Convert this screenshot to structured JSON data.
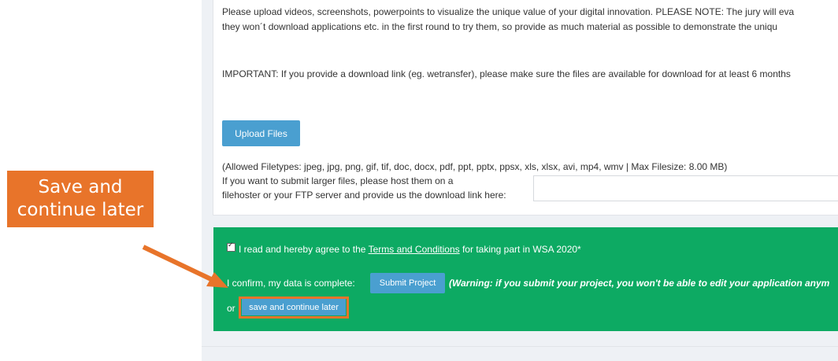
{
  "form": {
    "intro_line1": "Please upload videos, screenshots, powerpoints to visualize the unique value of your digital innovation. PLEASE NOTE: The jury will eva",
    "intro_line2": "they won´t download applications etc. in the first round to try them, so provide as much material as possible to demonstrate the uniqu",
    "important": "IMPORTANT: If you provide a download link (eg. wetransfer), please make sure the files are available for download for at least 6 months",
    "upload_label": "Upload Files",
    "allowed_types": "(Allowed Filetypes: jpeg, jpg, png, gif, tif, doc, docx, pdf, ppt, pptx, ppsx, xls, xlsx, avi, mp4, wmv | Max Filesize: 8.00 MB)",
    "larger_line1": "If you want to submit larger files, please host them on a",
    "larger_line2": "filehoster or your FTP server and provide us the download link here:",
    "link_value": ""
  },
  "confirm": {
    "agree_prefix": "I read and hereby agree to the ",
    "terms_link": "Terms and Conditions",
    "agree_suffix": " for taking part in WSA 2020*",
    "confirm_text": "I confirm, my data is complete:",
    "submit_label": "Submit Project",
    "warning": "(Warning: if you submit your project, you won't be able to edit your application anym",
    "or_label": "or",
    "save_label": "save and continue later"
  },
  "callout": {
    "line1": "Save and",
    "line2": "continue later"
  },
  "colors": {
    "accent_orange": "#e8742a",
    "confirm_green": "#0daa63",
    "button_blue": "#4a9fd0"
  }
}
